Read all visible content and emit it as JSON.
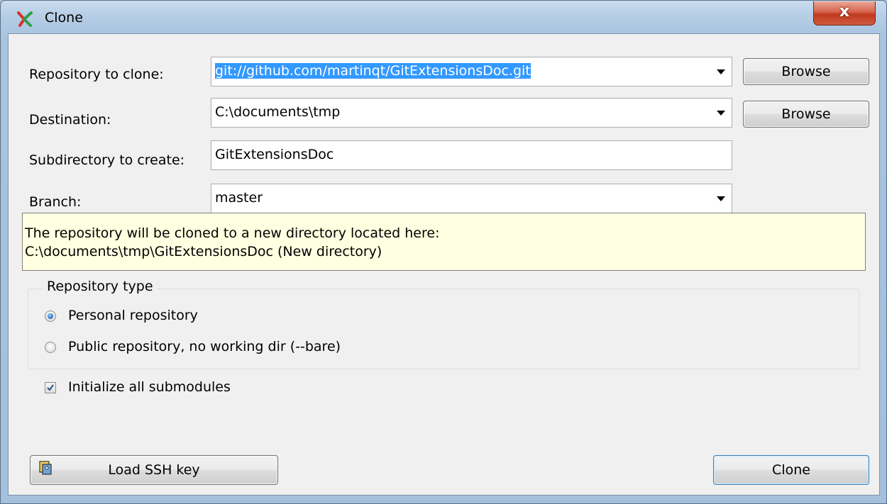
{
  "window": {
    "title": "Clone",
    "close_glyph": "x"
  },
  "form": {
    "repository_label": "Repository to clone:",
    "repository_value": "git://github.com/martinqt/GitExtensionsDoc.git",
    "destination_label": "Destination:",
    "destination_value": "C:\\documents\\tmp",
    "subdirectory_label": "Subdirectory to create:",
    "subdirectory_value": "GitExtensionsDoc",
    "branch_label": "Branch:",
    "branch_value": "master",
    "browse_label": "Browse"
  },
  "info": {
    "line1": "The repository will be cloned to a new directory located here:",
    "line2": "C:\\documents\\tmp\\GitExtensionsDoc (New directory)"
  },
  "repository_type": {
    "title": "Repository type",
    "options": [
      {
        "label": "Personal repository",
        "checked": true
      },
      {
        "label": "Public repository, no working dir  (--bare)",
        "checked": false
      }
    ]
  },
  "submodules": {
    "label": "Initialize all submodules",
    "checked": true
  },
  "footer": {
    "load_ssh_label": "Load SSH key",
    "clone_label": "Clone"
  },
  "colors": {
    "selection": "#3399ff",
    "info_background": "#ffffe1",
    "close_button": "#c0391f"
  },
  "icons": {
    "app": "git-extensions-icon",
    "ssh": "ssh-key-icon"
  }
}
